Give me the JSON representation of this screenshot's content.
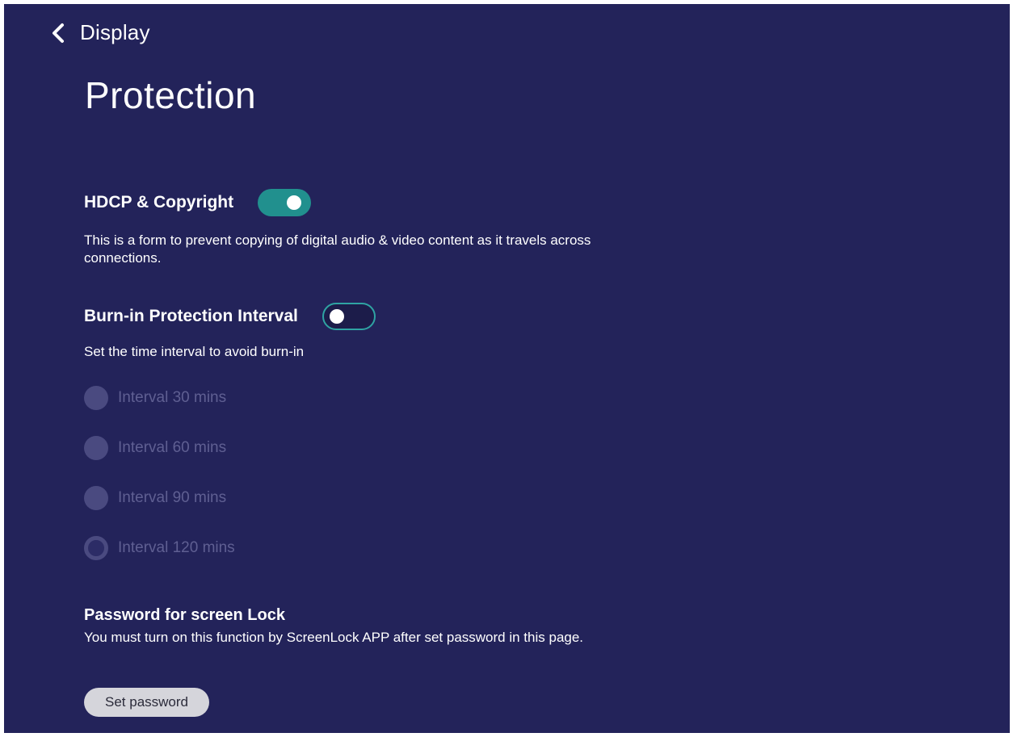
{
  "header": {
    "back_label": "Display",
    "title": "Protection"
  },
  "hdcp": {
    "label": "HDCP & Copyright",
    "enabled": true,
    "description": "This is a form to prevent copying of digital audio & video content as it travels across connections."
  },
  "burn_in": {
    "label": "Burn-in Protection Interval",
    "enabled": false,
    "description": "Set the time interval to avoid burn-in",
    "options": [
      {
        "label": "Interval 30 mins",
        "selected": false
      },
      {
        "label": "Interval 60 mins",
        "selected": false
      },
      {
        "label": "Interval 90 mins",
        "selected": false
      },
      {
        "label": "Interval 120 mins",
        "selected": true
      }
    ]
  },
  "screen_lock": {
    "label": "Password for screen Lock",
    "description": "You must turn on this function by ScreenLock APP after set password in this page.",
    "button_label": "Set password"
  },
  "colors": {
    "background": "#23235a",
    "accent": "#21908e",
    "disabled_text": "#5f5f92"
  }
}
